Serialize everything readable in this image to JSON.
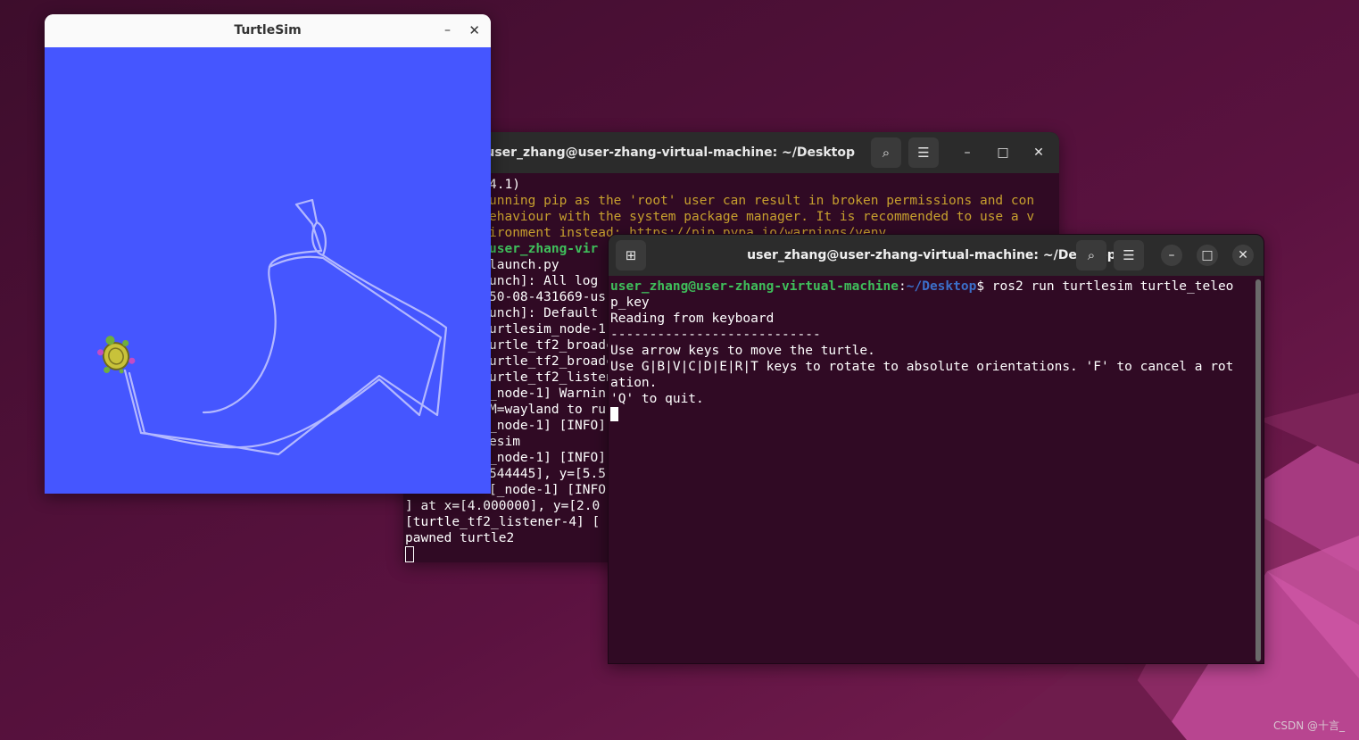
{
  "colors": {
    "desktop_bg": "#5a1240",
    "terminal_bg": "#300a24",
    "turtlesim_bg": "#4556ff",
    "turtle_path": "#b3b8ff",
    "prompt_user": "#3fbf5b",
    "prompt_path": "#3b6fc9"
  },
  "turtlesim": {
    "title": "TurtleSim",
    "minimize_icon": "minimize-icon",
    "close_icon": "close-icon"
  },
  "terminal_back": {
    "title": "user_zhang@user-zhang-virtual-machine: ~/Desktop",
    "lines": [
      {
        "text": "4.1)",
        "style": "plain"
      },
      {
        "text": "unning pip as the 'root' user can result in broken permissions and con",
        "style": "warn"
      },
      {
        "text": "ehaviour with the system package manager. It is recommended to use a v",
        "style": "warn"
      },
      {
        "text": "ironment instead: https://pip.pypa.io/warnings/venv",
        "style": "warn"
      },
      {
        "text": "user_zhang-vir",
        "style": "green"
      },
      {
        "text": "launch.py",
        "style": "plain"
      },
      {
        "text": "unch]: All log",
        "style": "plain"
      },
      {
        "text": "50-08-431669-us",
        "style": "plain"
      },
      {
        "text": "unch]: Default",
        "style": "plain"
      },
      {
        "text": "urtlesim_node-1]",
        "style": "plain"
      },
      {
        "text": "urtle_tf2_broadc",
        "style": "plain"
      },
      {
        "text": "urtle_tf2_broadc",
        "style": "plain"
      },
      {
        "text": "urtle_tf2_listen",
        "style": "plain"
      },
      {
        "text": "_node-1] Warnin",
        "style": "plain"
      },
      {
        "text": "M=wayland to ru",
        "style": "plain"
      },
      {
        "text": "_node-1] [INFO]",
        "style": "plain"
      },
      {
        "text": "esim",
        "style": "plain"
      },
      {
        "text": "_node-1] [INFO]",
        "style": "plain"
      },
      {
        "text": "544445], y=[5.5",
        "style": "plain"
      },
      {
        "text": "[_node-1] [INFO]",
        "style": "plain"
      },
      {
        "text": "] at x=[4.000000], y=[2.0",
        "style": "plain"
      },
      {
        "text": "[turtle_tf2_listener-4] [",
        "style": "plain"
      },
      {
        "text": "pawned turtle2",
        "style": "plain"
      }
    ]
  },
  "terminal_front": {
    "title": "user_zhang@user-zhang-virtual-machine: ~/Desktop",
    "prompt_user": "user_zhang@user-zhang-virtual-machine",
    "prompt_sep": ":",
    "prompt_path": "~/Desktop",
    "prompt_dollar": "$",
    "command": " ros2 run turtlesim turtle_teleo",
    "lines": [
      "p_key",
      "Reading from keyboard",
      "---------------------------",
      "Use arrow keys to move the turtle.",
      "Use G|B|V|C|D|E|R|T keys to rotate to absolute orientations. 'F' to cancel a rot",
      "ation.",
      "'Q' to quit."
    ]
  },
  "watermark": "CSDN @十言_"
}
